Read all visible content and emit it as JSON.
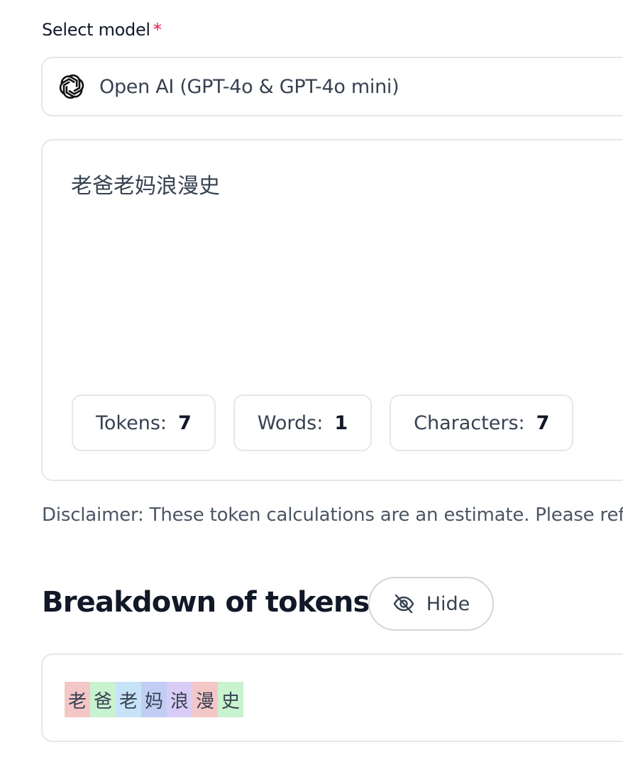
{
  "form": {
    "select_label": "Select model",
    "required_mark": "*",
    "model_value": "Open AI (GPT-4o & GPT-4o mini)",
    "model_icon": "openai-logo-icon"
  },
  "editor": {
    "text": "老爸老妈浪漫史"
  },
  "stats": [
    {
      "label": "Tokens:",
      "value": "7"
    },
    {
      "label": "Words:",
      "value": "1"
    },
    {
      "label": "Characters:",
      "value": "7"
    }
  ],
  "disclaimer": "Disclaimer: These token calculations are an estimate. Please refe",
  "breakdown": {
    "title": "Breakdown of tokens",
    "hide_label": "Hide",
    "hide_icon": "eye-off-icon",
    "tokens": [
      {
        "text": "老",
        "color": "#f4c7c7"
      },
      {
        "text": "爸",
        "color": "#c9f2cf"
      },
      {
        "text": "老",
        "color": "#c7e3f7"
      },
      {
        "text": "妈",
        "color": "#c2cdf5"
      },
      {
        "text": "浪",
        "color": "#d9ccf7"
      },
      {
        "text": "漫",
        "color": "#f4c7c7"
      },
      {
        "text": "史",
        "color": "#c9f2cf"
      }
    ]
  }
}
